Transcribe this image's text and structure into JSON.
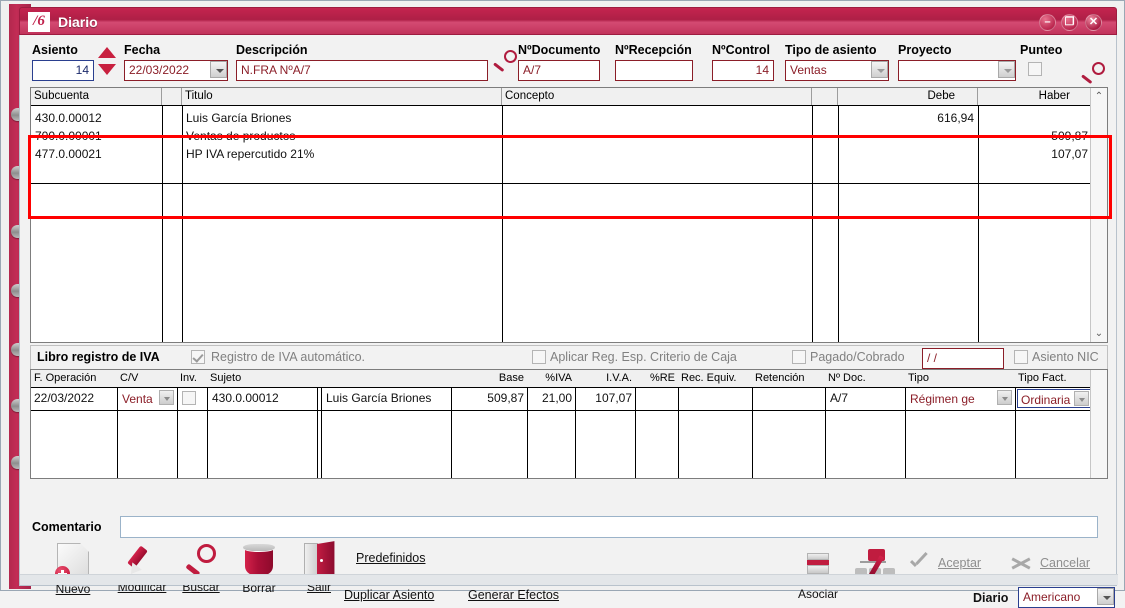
{
  "window": {
    "title": "Diario",
    "logo_text": "/6",
    "minimize_label": "–",
    "maximize_label": "❐",
    "close_label": "✕"
  },
  "header": {
    "asiento": {
      "label": "Asiento",
      "value": "14"
    },
    "fecha": {
      "label": "Fecha",
      "value": "22/03/2022"
    },
    "descripcion": {
      "label": "Descripción",
      "value": "N.FRA NºA/7"
    },
    "num_documento": {
      "label": "NºDocumento",
      "value": "A/7"
    },
    "num_recepcion": {
      "label": "NºRecepción",
      "value": ""
    },
    "num_control": {
      "label": "NºControl",
      "value": "14"
    },
    "tipo_asiento": {
      "label": "Tipo de asiento",
      "value": "Ventas"
    },
    "proyecto": {
      "label": "Proyecto",
      "value": ""
    },
    "punteo": {
      "label": "Punteo",
      "checked": false
    },
    "search_icon": "magnifier-icon"
  },
  "journal_grid": {
    "columns": [
      "Subcuenta",
      "Titulo",
      "Concepto",
      "Debe",
      "Haber"
    ],
    "rows": [
      {
        "subcuenta": "430.0.00012",
        "titulo": "Luis García Briones",
        "concepto": "",
        "debe": "616,94",
        "haber": ""
      },
      {
        "subcuenta": "700.0.00001",
        "titulo": "Ventas de productos",
        "concepto": "",
        "debe": "",
        "haber": "509,87"
      },
      {
        "subcuenta": "477.0.00021",
        "titulo": "HP IVA repercutido 21%",
        "concepto": "",
        "debe": "",
        "haber": "107,07"
      }
    ],
    "highlight_color": "#ff0000",
    "scroll_up": "⌃",
    "scroll_down": "⌄"
  },
  "iva_bar": {
    "title": "Libro registro de IVA",
    "registro_automatico": {
      "label": "Registro de IVA automático.",
      "checked": true
    },
    "criterio_caja": {
      "label": "Aplicar Reg. Esp. Criterio de Caja",
      "checked": false
    },
    "pagado_cobrado": {
      "label": "Pagado/Cobrado",
      "checked": false
    },
    "fecha_pago": {
      "value": "/  /"
    },
    "asiento_nic": {
      "label": "Asiento NIC",
      "checked": false
    }
  },
  "iva_grid": {
    "columns": [
      "F. Operación",
      "C/V",
      "Inv.",
      "Sujeto",
      "",
      "",
      "Base",
      "%IVA",
      "I.V.A.",
      "%RE",
      "Rec. Equiv.",
      "Retención",
      "Nº Doc.",
      "Tipo",
      "Tipo Fact."
    ],
    "row": {
      "f_operacion": "22/03/2022",
      "cv": "Venta",
      "inv": false,
      "sujeto_codigo": "430.0.00012",
      "sujeto_nombre": "Luis García Briones",
      "base": "509,87",
      "pct_iva": "21,00",
      "iva": "107,07",
      "pct_re": "",
      "rec_equiv": "",
      "retencion": "",
      "n_doc": "A/7",
      "tipo": "Régimen ge",
      "tipo_fact": "Ordinaria"
    }
  },
  "comentario": {
    "label": "Comentario",
    "value": "",
    "placeholder": ""
  },
  "toolbar": {
    "buttons": [
      {
        "label": "Nuevo",
        "accel": "N",
        "icon": "new-document-icon"
      },
      {
        "label": "Modificar",
        "accel": "M",
        "icon": "pen-icon"
      },
      {
        "label": "Buscar",
        "accel": "B",
        "icon": "magnifier-icon"
      },
      {
        "label": "Borrar",
        "accel": "",
        "icon": "trash-bin-icon"
      },
      {
        "label": "Salir",
        "accel": "S",
        "icon": "exit-door-icon"
      }
    ],
    "links": [
      {
        "label": "Predefinidos",
        "accel": "P"
      },
      {
        "label": "Duplicar Asiento",
        "accel": "D"
      },
      {
        "label": "Generar Efectos",
        "accel": "G"
      }
    ],
    "asociar": {
      "label": "Asociar",
      "icon": "associate-icon"
    },
    "efectos_icon": "generate-effects-icon",
    "aceptar": {
      "label": "Aceptar",
      "accel": "A",
      "icon": "check-icon"
    },
    "cancelar": {
      "label": "Cancelar",
      "accel": "C",
      "icon": "x-icon"
    },
    "diario": {
      "label": "Diario",
      "value": "Americano"
    }
  }
}
